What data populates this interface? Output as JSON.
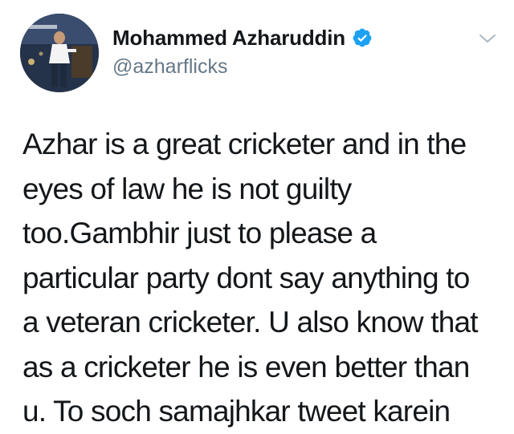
{
  "author": {
    "display_name": "Mohammed Azharuddin",
    "handle": "@azharflicks",
    "verified": true
  },
  "tweet": {
    "lines": [
      "Azhar is a great cricketer and in the",
      "eyes of law he is not guilty",
      "too.Gambhir just to please a",
      "particular party dont say anything to",
      "a veteran cricketer. U also know that",
      "as a cricketer he is even better than",
      "u. To soch samajhkar tweet karein"
    ]
  },
  "colors": {
    "verified_badge": "#1da1f2",
    "handle": "#657786",
    "text": "#14171a",
    "caret": "#aab8c2"
  },
  "icons": {
    "verified": "verified-badge-icon",
    "caret": "chevron-down-icon",
    "avatar": "profile-photo"
  }
}
